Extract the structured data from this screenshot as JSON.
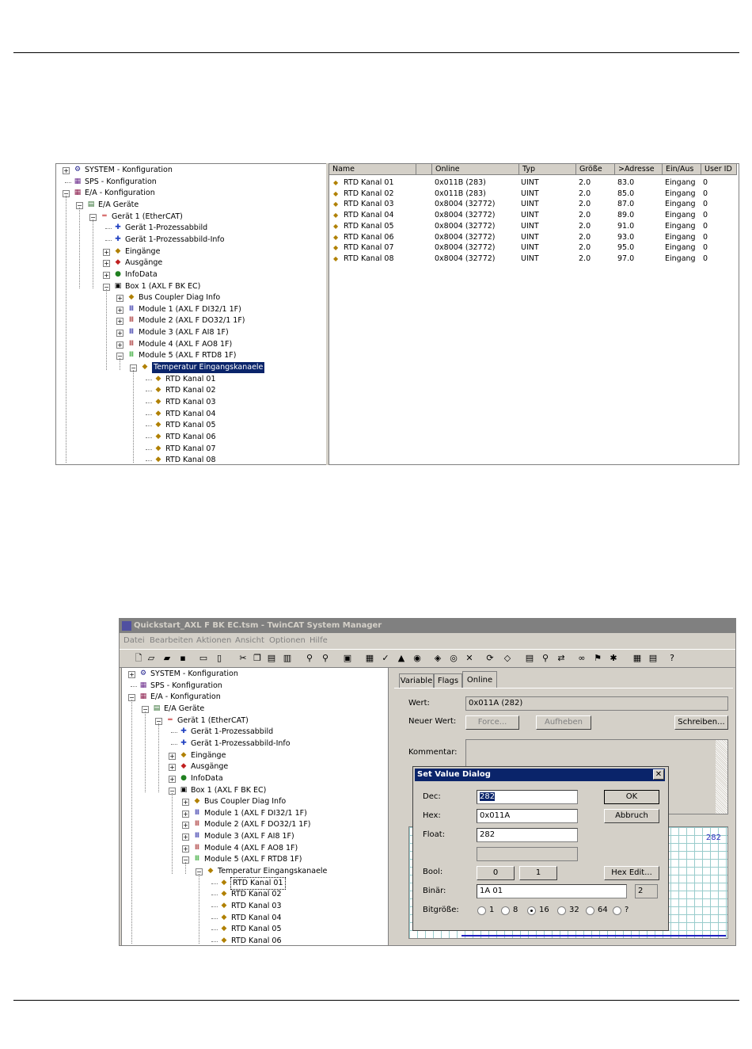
{
  "tree": {
    "items": [
      {
        "label": "SYSTEM - Konfiguration",
        "icon": "system-icon"
      },
      {
        "label": "SPS - Konfiguration",
        "icon": "plc-icon"
      },
      {
        "label": "E/A - Konfiguration",
        "icon": "io-config-icon"
      },
      {
        "label": "E/A Geräte",
        "icon": "devices-icon"
      },
      {
        "label": "Gerät 1 (EtherCAT)",
        "icon": "ethercat-icon"
      },
      {
        "label": "Gerät 1-Prozessabbild",
        "icon": "process-image-icon"
      },
      {
        "label": "Gerät 1-Prozessabbild-Info",
        "icon": "process-image-icon"
      },
      {
        "label": "Eingänge",
        "icon": "inputs-icon"
      },
      {
        "label": "Ausgänge",
        "icon": "outputs-icon"
      },
      {
        "label": "InfoData",
        "icon": "infodata-icon"
      },
      {
        "label": "Box 1 (AXL F BK EC)",
        "icon": "box-icon"
      },
      {
        "label": "Bus Coupler Diag Info",
        "icon": "diag-icon"
      },
      {
        "label": "Module 1 (AXL F DI32/1 1F)",
        "icon": "di-module-icon"
      },
      {
        "label": "Module 2 (AXL F DO32/1 1F)",
        "icon": "do-module-icon"
      },
      {
        "label": "Module 3 (AXL F AI8 1F)",
        "icon": "ai-module-icon"
      },
      {
        "label": "Module 4 (AXL F AO8 1F)",
        "icon": "ao-module-icon"
      },
      {
        "label": "Module 5 (AXL F RTD8 1F)",
        "icon": "rtd-module-icon"
      },
      {
        "label": "Temperatur Eingangskanaele",
        "icon": "channel-group-icon"
      },
      {
        "label": "RTD Kanal 01",
        "icon": "variable-icon"
      },
      {
        "label": "RTD Kanal 02",
        "icon": "variable-icon"
      },
      {
        "label": "RTD Kanal 03",
        "icon": "variable-icon"
      },
      {
        "label": "RTD Kanal 04",
        "icon": "variable-icon"
      },
      {
        "label": "RTD Kanal 05",
        "icon": "variable-icon"
      },
      {
        "label": "RTD Kanal 06",
        "icon": "variable-icon"
      },
      {
        "label": "RTD Kanal 07",
        "icon": "variable-icon"
      },
      {
        "label": "RTD Kanal 08",
        "icon": "variable-icon"
      }
    ]
  },
  "table": {
    "columns": [
      "Name",
      "Online",
      "Typ",
      "Größe",
      ">Adresse",
      "Ein/Aus",
      "User ID"
    ],
    "rows": [
      [
        "RTD Kanal 01",
        "0x011B (283)",
        "UINT",
        "2.0",
        "83.0",
        "Eingang",
        "0"
      ],
      [
        "RTD Kanal 02",
        "0x011B (283)",
        "UINT",
        "2.0",
        "85.0",
        "Eingang",
        "0"
      ],
      [
        "RTD Kanal 03",
        "0x8004 (32772)",
        "UINT",
        "2.0",
        "87.0",
        "Eingang",
        "0"
      ],
      [
        "RTD Kanal 04",
        "0x8004 (32772)",
        "UINT",
        "2.0",
        "89.0",
        "Eingang",
        "0"
      ],
      [
        "RTD Kanal 05",
        "0x8004 (32772)",
        "UINT",
        "2.0",
        "91.0",
        "Eingang",
        "0"
      ],
      [
        "RTD Kanal 06",
        "0x8004 (32772)",
        "UINT",
        "2.0",
        "93.0",
        "Eingang",
        "0"
      ],
      [
        "RTD Kanal 07",
        "0x8004 (32772)",
        "UINT",
        "2.0",
        "95.0",
        "Eingang",
        "0"
      ],
      [
        "RTD Kanal 08",
        "0x8004 (32772)",
        "UINT",
        "2.0",
        "97.0",
        "Eingang",
        "0"
      ]
    ]
  },
  "window": {
    "title": "Quickstart_AXL F BK EC.tsm - TwinCAT System Manager",
    "menu": [
      "Datei",
      "Bearbeiten",
      "Aktionen",
      "Ansicht",
      "Optionen",
      "Hilfe"
    ],
    "tabs": [
      "Variable",
      "Flags",
      "Online"
    ],
    "online": {
      "wert_label": "Wert:",
      "wert_value": "0x011A (282)",
      "neuer_wert_label": "Neuer Wert:",
      "force_button": "Force...",
      "aufheben_button": "Aufheben",
      "schreiben_button": "Schreiben...",
      "kommentar_label": "Kommentar:",
      "chart_value": "282"
    },
    "dialog": {
      "title": "Set Value Dialog",
      "dec_label": "Dec:",
      "dec_value": "282",
      "hex_label": "Hex:",
      "hex_value": "0x011A",
      "float_label": "Float:",
      "float_value": "282",
      "ok_button": "OK",
      "abbruch_button": "Abbruch",
      "bool_label": "Bool:",
      "bool_0": "0",
      "bool_1": "1",
      "hexedit_button": "Hex Edit...",
      "binaer_label": "Binär:",
      "binaer_value": "1A 01",
      "binaer_count": "2",
      "bitgroesse_label": "Bitgröße:",
      "bit_options": [
        "1",
        "8",
        "16",
        "32",
        "64",
        "?"
      ],
      "bit_selected": "16"
    }
  },
  "colors": {
    "selection": "#0a246a",
    "chrome": "#d4d0c8"
  }
}
